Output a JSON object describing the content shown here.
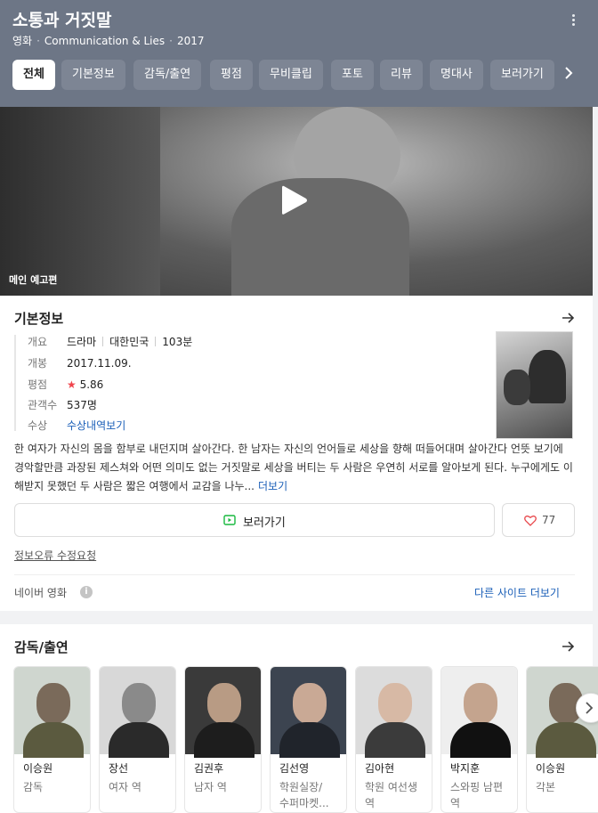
{
  "header": {
    "title": "소통과 거짓말",
    "meta": [
      "영화",
      "Communication & Lies",
      "2017"
    ],
    "tabs": [
      "전체",
      "기본정보",
      "감독/출연",
      "평점",
      "무비클립",
      "포토",
      "리뷰",
      "명대사",
      "보러가기"
    ],
    "active_tab": "전체"
  },
  "video": {
    "label": "메인 예고편"
  },
  "basic_info": {
    "title": "기본정보",
    "overview_label": "개요",
    "genre": "드라마",
    "country": "대한민국",
    "runtime": "103분",
    "release_label": "개봉",
    "release": "2017.11.09.",
    "rating_label": "평점",
    "rating": "5.86",
    "audience_label": "관객수",
    "audience": "537명",
    "award_label": "수상",
    "award_link": "수상내역보기",
    "summary": "한 여자가 자신의 몸을 함부로 내던지며 살아간다. 한 남자는 자신의 언어들로 세상을 향해 떠들어대며 살아간다 언뜻 보기에 경악할만큼 과장된 제스쳐와 어떤 의미도 없는 거짓말로 세상을 버티는 두 사람은 우연히 서로를 알아보게 된다. 누구에게도 이해받지 못했던 두 사람은 짧은 여행에서 교감을 나누...",
    "more_label": "더보기",
    "watch_label": "보러가기",
    "like_count": "77",
    "report_label": "정보오류 수정요청",
    "source_label": "네이버 영화",
    "other_sites_label": "다른 사이트 더보기"
  },
  "cast": {
    "title": "감독/출연",
    "people": [
      {
        "name": "이승원",
        "role": "감독"
      },
      {
        "name": "장선",
        "role": "여자 역"
      },
      {
        "name": "김권후",
        "role": "남자 역"
      },
      {
        "name": "김선영",
        "role": "학원실장/수퍼마켓..."
      },
      {
        "name": "김아현",
        "role": "학원 여선생 역"
      },
      {
        "name": "박지훈",
        "role": "스와핑 남편 역"
      },
      {
        "name": "이승원",
        "role": "각본"
      }
    ]
  },
  "colors": {
    "header_bg": "#6d7686",
    "link": "#1b5fb8",
    "star": "#f0444c",
    "watch_icon": "#18b93f"
  }
}
